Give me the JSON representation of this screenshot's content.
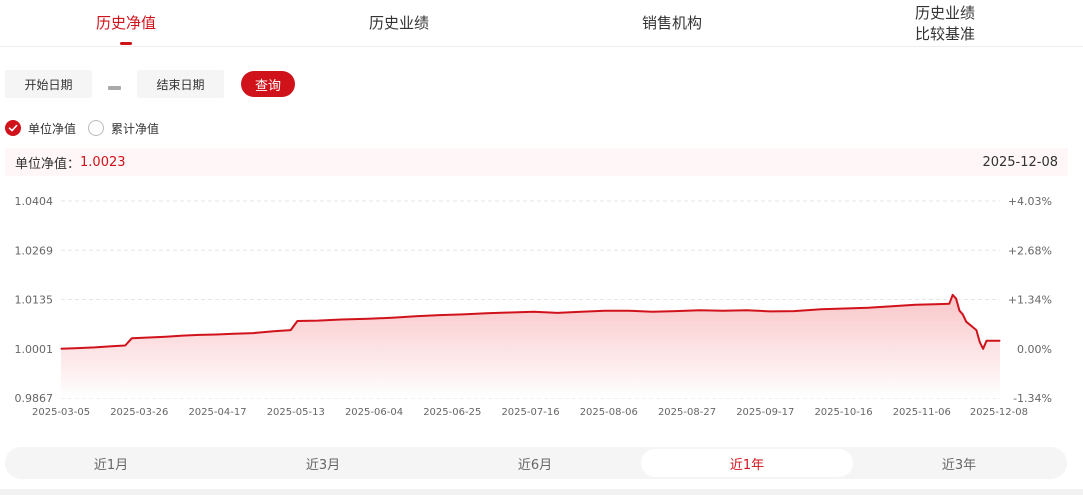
{
  "tabs": [
    {
      "label": "历史净值",
      "active": true
    },
    {
      "label": "历史业绩",
      "active": false
    },
    {
      "label": "销售机构",
      "active": false
    },
    {
      "label": "历史业绩\n比较基准",
      "active": false
    }
  ],
  "filters": {
    "start_date_placeholder": "开始日期",
    "end_date_placeholder": "结束日期",
    "query_label": "查询"
  },
  "radio": {
    "unit_nav_label": "单位净值",
    "cum_nav_label": "累计净值",
    "selected": "unit_nav"
  },
  "info": {
    "label": "单位净值：",
    "value": "1.0023",
    "date": "2025-12-08"
  },
  "range_tabs": [
    {
      "label": "近1月",
      "active": false
    },
    {
      "label": "近3月",
      "active": false
    },
    {
      "label": "近6月",
      "active": false
    },
    {
      "label": "近1年",
      "active": true
    },
    {
      "label": "近3年",
      "active": false
    }
  ],
  "colors": {
    "accent": "#d0121b",
    "line": "#d0121b",
    "area_top": "#f9c3c6",
    "area_bottom": "#ffffff",
    "grid": "#e6e6e6"
  },
  "chart_data": {
    "type": "area",
    "ylim": [
      0.9867,
      1.0404
    ],
    "y_ticks": [
      "1.0404",
      "1.0269",
      "1.0135",
      "1.0001",
      "0.9867"
    ],
    "y2_ticks": [
      "+4.03%",
      "+2.68%",
      "+1.34%",
      "0.00%",
      "-1.34%"
    ],
    "x_tick_labels": [
      "2025-03-05",
      "2025-03-26",
      "2025-04-17",
      "2025-05-13",
      "2025-06-04",
      "2025-06-25",
      "2025-07-16",
      "2025-08-06",
      "2025-08-27",
      "2025-09-17",
      "2025-10-16",
      "2025-11-06",
      "2025-12-08"
    ],
    "x": [
      "2025-03-05",
      "2025-03-10",
      "2025-03-15",
      "2025-03-20",
      "2025-03-24",
      "2025-03-26",
      "2025-03-31",
      "2025-04-05",
      "2025-04-10",
      "2025-04-15",
      "2025-04-20",
      "2025-04-25",
      "2025-05-01",
      "2025-05-07",
      "2025-05-12",
      "2025-05-14",
      "2025-05-20",
      "2025-05-27",
      "2025-06-04",
      "2025-06-11",
      "2025-06-18",
      "2025-06-25",
      "2025-07-02",
      "2025-07-09",
      "2025-07-16",
      "2025-07-23",
      "2025-07-30",
      "2025-08-06",
      "2025-08-13",
      "2025-08-20",
      "2025-08-27",
      "2025-09-03",
      "2025-09-10",
      "2025-09-17",
      "2025-09-24",
      "2025-10-01",
      "2025-10-08",
      "2025-10-16",
      "2025-10-23",
      "2025-10-30",
      "2025-11-06",
      "2025-11-13",
      "2025-11-20",
      "2025-11-23",
      "2025-11-24",
      "2025-11-25",
      "2025-11-26",
      "2025-11-27",
      "2025-11-28",
      "2025-12-01",
      "2025-12-02",
      "2025-12-03",
      "2025-12-04",
      "2025-12-05",
      "2025-12-08"
    ],
    "values": [
      1.0001,
      1.0003,
      1.0005,
      1.0008,
      1.001,
      1.003,
      1.0032,
      1.0034,
      1.0037,
      1.0039,
      1.004,
      1.0042,
      1.0044,
      1.0049,
      1.0052,
      1.0077,
      1.0078,
      1.0081,
      1.0083,
      1.0086,
      1.009,
      1.0093,
      1.0095,
      1.0098,
      1.01,
      1.0102,
      1.0099,
      1.0102,
      1.0105,
      1.0105,
      1.0102,
      1.0104,
      1.0106,
      1.0105,
      1.0106,
      1.0103,
      1.0104,
      1.0109,
      1.0111,
      1.0113,
      1.0117,
      1.0121,
      1.0123,
      1.0124,
      1.0148,
      1.0138,
      1.0105,
      1.0095,
      1.0075,
      1.0052,
      1.002,
      1.0001,
      1.0023,
      1.0023,
      1.0023
    ],
    "grid": true
  }
}
